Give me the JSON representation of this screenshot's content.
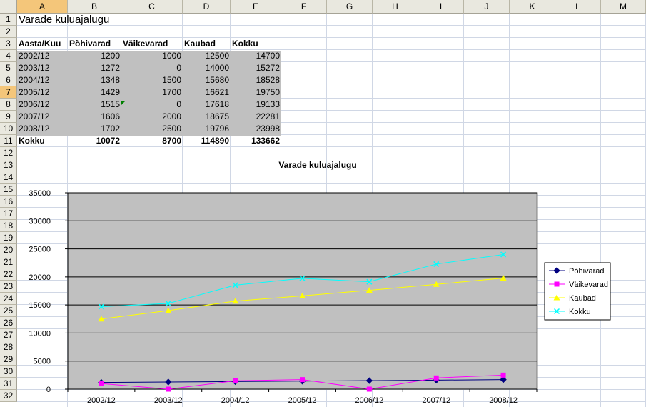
{
  "columns": [
    "A",
    "B",
    "C",
    "D",
    "E",
    "F",
    "G",
    "H",
    "I",
    "J",
    "K",
    "L",
    "M"
  ],
  "rows": [
    "1",
    "2",
    "3",
    "4",
    "5",
    "6",
    "7",
    "8",
    "9",
    "10",
    "11",
    "12",
    "13",
    "14",
    "15",
    "16",
    "17",
    "18",
    "19",
    "20",
    "21",
    "22",
    "23",
    "24",
    "25",
    "26",
    "27",
    "28",
    "29",
    "30",
    "31",
    "32"
  ],
  "title": "Varade kuluajalugu",
  "headers": [
    "Aasta/Kuu",
    "Põhivarad",
    "Väikevarad",
    "Kaubad",
    "Kokku"
  ],
  "table": [
    [
      "2002/12",
      "1200",
      "1000",
      "12500",
      "14700"
    ],
    [
      "2003/12",
      "1272",
      "0",
      "14000",
      "15272"
    ],
    [
      "2004/12",
      "1348",
      "1500",
      "15680",
      "18528"
    ],
    [
      "2005/12",
      "1429",
      "1700",
      "16621",
      "19750"
    ],
    [
      "2006/12",
      "1515",
      "0",
      "17618",
      "19133"
    ],
    [
      "2007/12",
      "1606",
      "2000",
      "18675",
      "22281"
    ],
    [
      "2008/12",
      "1702",
      "2500",
      "19796",
      "23998"
    ]
  ],
  "totals": [
    "Kokku",
    "10072",
    "8700",
    "114890",
    "133662"
  ],
  "colors": {
    "plot_bg": "#c0c0c0",
    "header_bg": "#e9e8df",
    "selected_header": "#f4c67a"
  },
  "chart_data": {
    "type": "line",
    "title": "Varade kuluajalugu",
    "categories": [
      "2002/12",
      "2003/12",
      "2004/12",
      "2005/12",
      "2006/12",
      "2007/12",
      "2008/12"
    ],
    "ylim": [
      0,
      35000
    ],
    "yticks": [
      "0",
      "5000",
      "10000",
      "15000",
      "20000",
      "25000",
      "30000",
      "35000"
    ],
    "grid": true,
    "legend_position": "right",
    "series": [
      {
        "name": "Põhivarad",
        "color": "#000080",
        "marker": "diamond",
        "values": [
          1200,
          1272,
          1348,
          1429,
          1515,
          1606,
          1702
        ]
      },
      {
        "name": "Väikevarad",
        "color": "#ff00ff",
        "marker": "square",
        "values": [
          1000,
          0,
          1500,
          1700,
          0,
          2000,
          2500
        ]
      },
      {
        "name": "Kaubad",
        "color": "#ffff00",
        "marker": "triangle",
        "values": [
          12500,
          14000,
          15680,
          16621,
          17618,
          18675,
          19796
        ]
      },
      {
        "name": "Kokku",
        "color": "#00ffff",
        "marker": "x",
        "values": [
          14700,
          15272,
          18528,
          19750,
          19133,
          22281,
          23998
        ]
      }
    ]
  }
}
